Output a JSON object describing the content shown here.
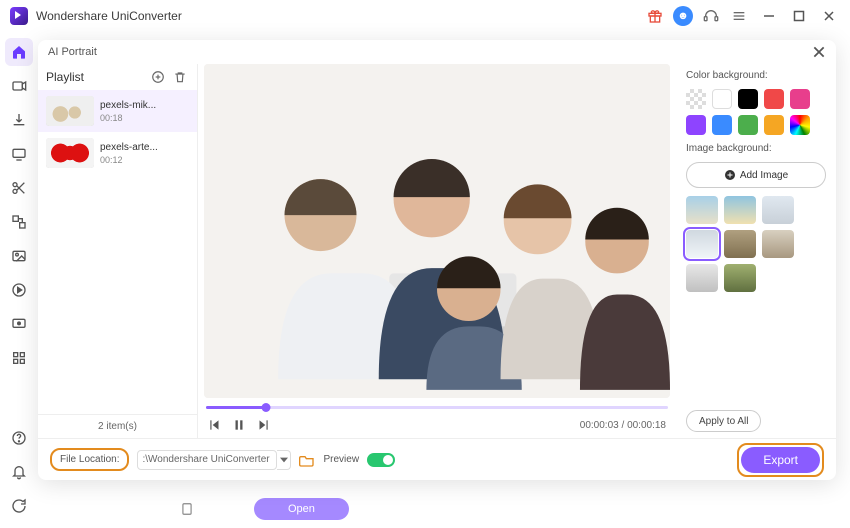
{
  "app": {
    "name": "Wondershare UniConverter"
  },
  "panel": {
    "title": "AI Portrait"
  },
  "playlist": {
    "label": "Playlist",
    "items": [
      {
        "name": "pexels-mik...",
        "duration": "00:18"
      },
      {
        "name": "pexels-arte...",
        "duration": "00:12"
      }
    ],
    "count_label": "2 item(s)"
  },
  "player": {
    "current": "00:00:03",
    "total": "00:00:18",
    "progress_pct": 13
  },
  "options": {
    "color_bg_label": "Color background:",
    "colors": [
      "transparent",
      "#ffffff",
      "#000000",
      "#f04848",
      "#e83e8c",
      "#8e44ff",
      "#3a8bff",
      "#4cae4c",
      "#f5a623",
      "rainbow"
    ],
    "image_bg_label": "Image background:",
    "add_image_label": "Add Image",
    "apply_all_label": "Apply to All"
  },
  "footer": {
    "file_location_label": "File Location:",
    "file_location_value": ":\\Wondershare UniConverter",
    "preview_label": "Preview",
    "export_label": "Export"
  },
  "bottom": {
    "open_label": "Open"
  }
}
